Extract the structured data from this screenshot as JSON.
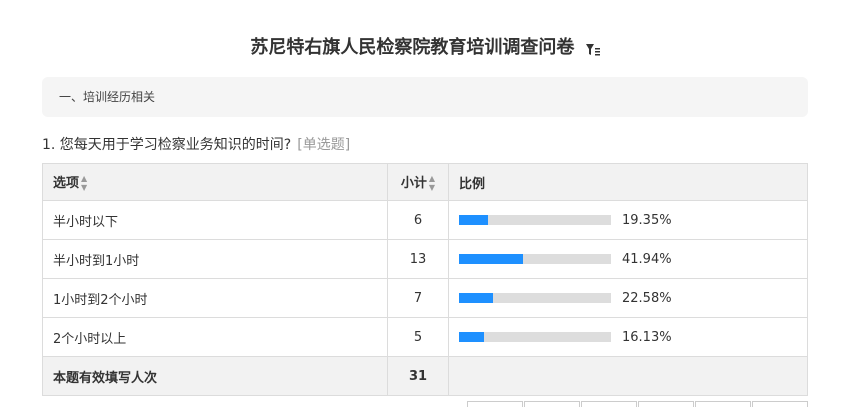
{
  "survey": {
    "title": "苏尼特右旗人民检察院教育培训调查问卷"
  },
  "section": {
    "label": "一、培训经历相关"
  },
  "question": {
    "text": "1. 您每天用于学习检察业务知识的时间?",
    "type": "[单选题]"
  },
  "table": {
    "headers": {
      "option": "选项",
      "count": "小计",
      "ratio": "比例"
    },
    "rows": [
      {
        "option": "半小时以下",
        "count": "6",
        "percent": "19.35%",
        "fraction": 0.1935
      },
      {
        "option": "半小时到1小时",
        "count": "13",
        "percent": "41.94%",
        "fraction": 0.4194
      },
      {
        "option": "1小时到2个小时",
        "count": "7",
        "percent": "22.58%",
        "fraction": 0.2258
      },
      {
        "option": "2个小时以上",
        "count": "5",
        "percent": "16.13%",
        "fraction": 0.1613
      }
    ],
    "total": {
      "label": "本题有效填写人次",
      "count": "31"
    }
  },
  "colors": {
    "bar_fill": "#1e90ff",
    "bar_track": "#dddddd"
  },
  "icons": {
    "title_icon": "filter-icon",
    "sort_icon": "sort-icon"
  }
}
